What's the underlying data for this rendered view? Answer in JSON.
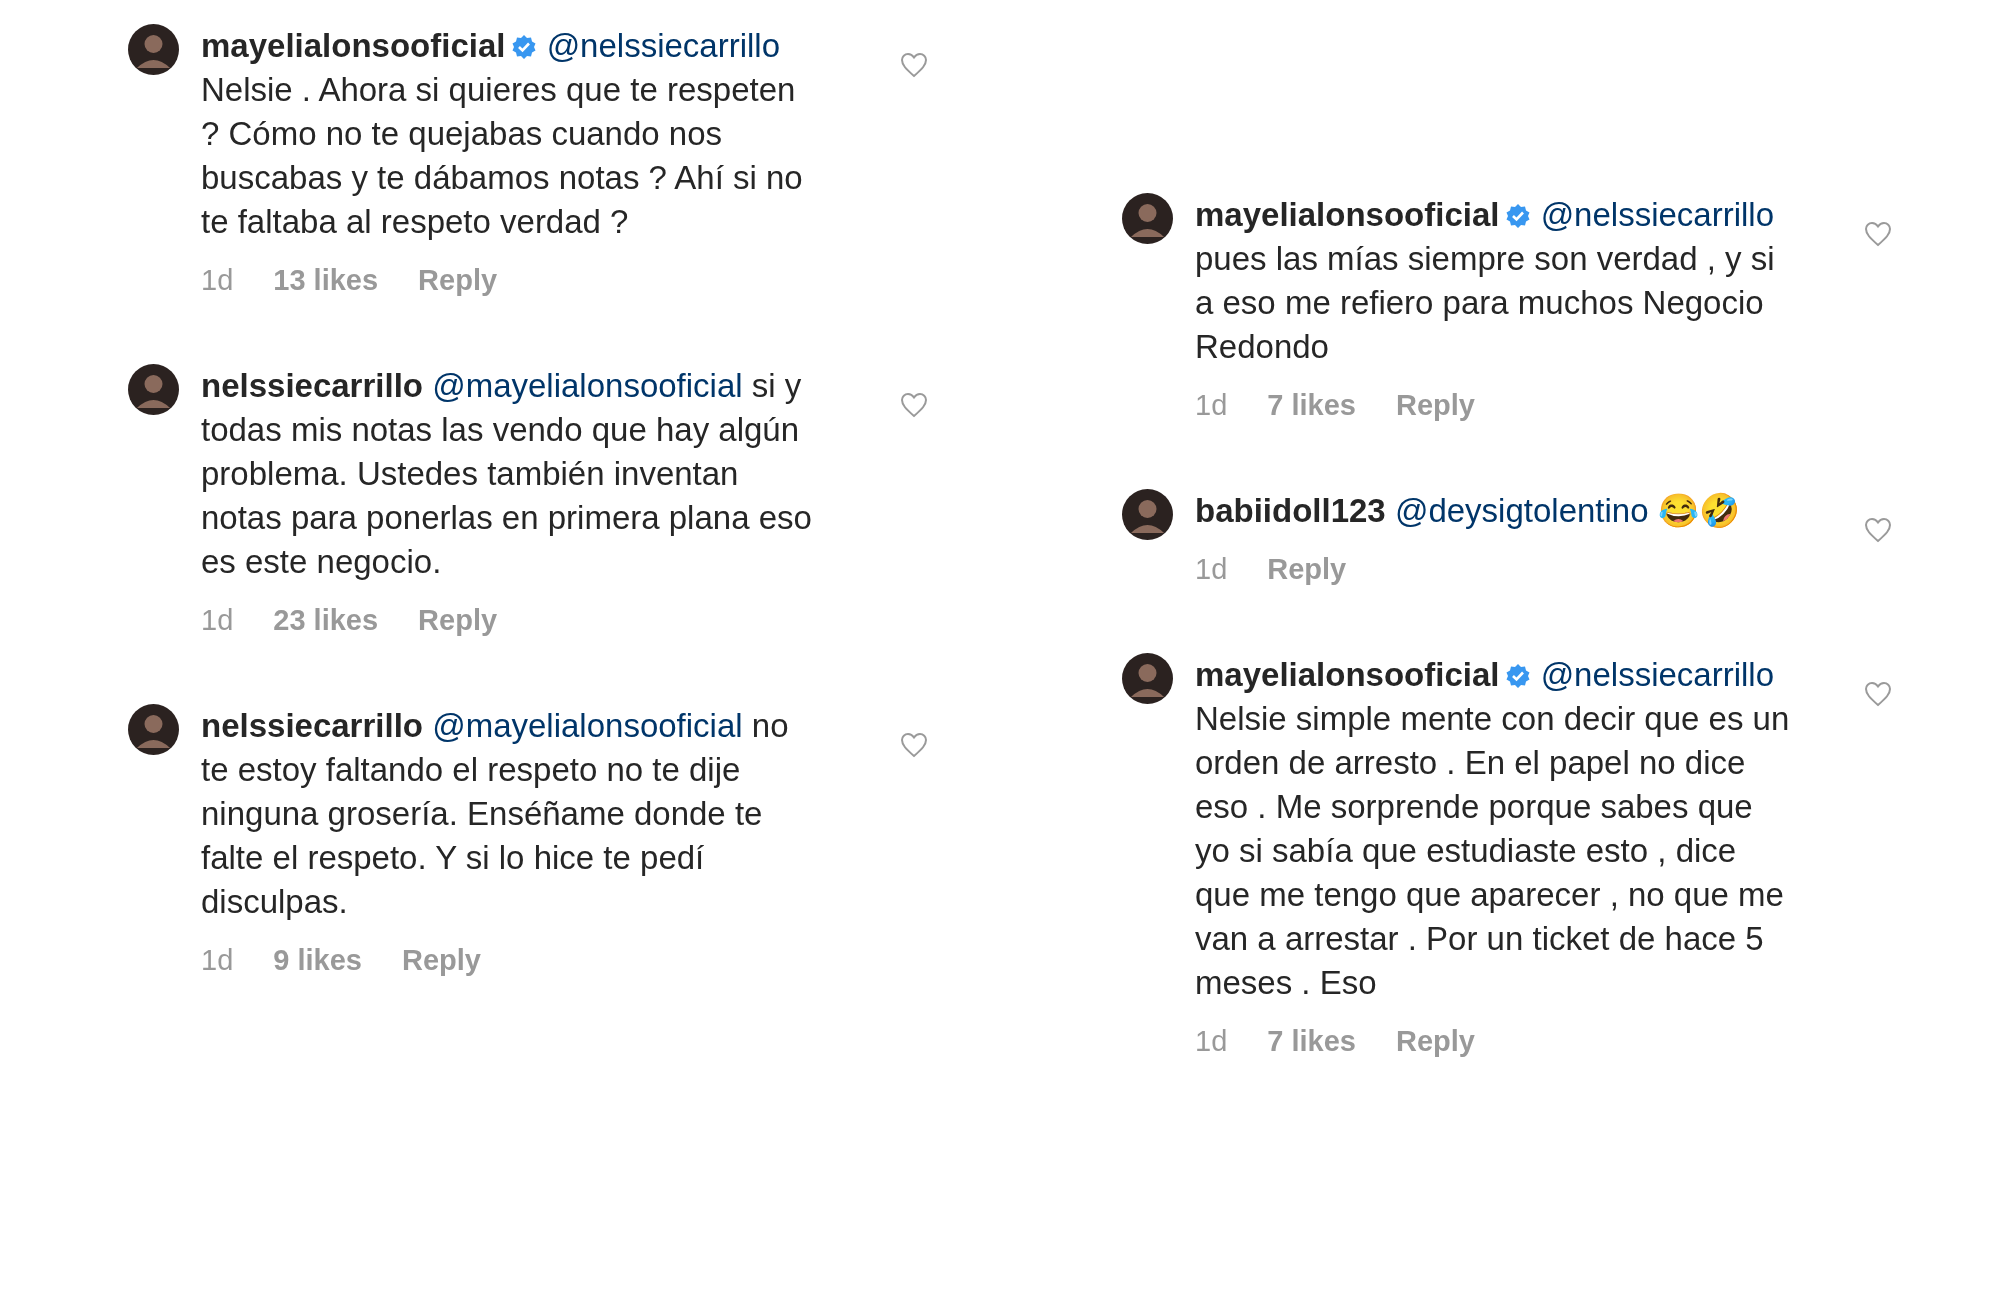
{
  "columns": [
    {
      "comments": [
        {
          "user": "mayelialonsooficial",
          "verified": true,
          "mention": "@nelssiecarrillo",
          "text": "Nelsie . Ahora si quieres que te respeten ? Cómo no te quejabas cuando nos buscabas y te dábamos notas ? Ahí si no te faltaba al respeto verdad ?",
          "time": "1d",
          "likes": "13 likes",
          "reply": "Reply"
        },
        {
          "user": "nelssiecarrillo",
          "verified": false,
          "mention": "@mayelialonsooficial",
          "text": "si y todas mis notas las vendo que hay algún problema. Ustedes también inventan notas para ponerlas en primera plana eso es este negocio.",
          "time": "1d",
          "likes": "23 likes",
          "reply": "Reply"
        },
        {
          "user": "nelssiecarrillo",
          "verified": false,
          "mention": "@mayelialonsooficial",
          "text": "no te estoy faltando el respeto no te dije ninguna grosería. Enséñame donde te falte el respeto. Y si lo hice te pedí disculpas.",
          "time": "1d",
          "likes": "9 likes",
          "reply": "Reply"
        }
      ]
    },
    {
      "comments": [
        {
          "user": "mayelialonsooficial",
          "verified": true,
          "mention": "@nelssiecarrillo",
          "text": "pues las mías siempre son verdad , y si a eso me refiero para muchos Negocio Redondo",
          "time": "1d",
          "likes": "7 likes",
          "reply": "Reply"
        },
        {
          "user": "babiidoll123",
          "verified": false,
          "mention": "@deysigtolentino",
          "text": "😂🤣",
          "time": "1d",
          "reply": "Reply"
        },
        {
          "user": "mayelialonsooficial",
          "verified": true,
          "mention": "@nelssiecarrillo",
          "text": "Nelsie simple mente con decir que es un orden de arresto . En el papel no dice eso . Me sorprende porque sabes que yo si sabía que estudiaste esto , dice que me tengo que aparecer , no que me van a arrestar . Por un ticket de hace 5 meses . Eso",
          "time": "1d",
          "likes": "7 likes",
          "reply": "Reply"
        }
      ]
    }
  ]
}
